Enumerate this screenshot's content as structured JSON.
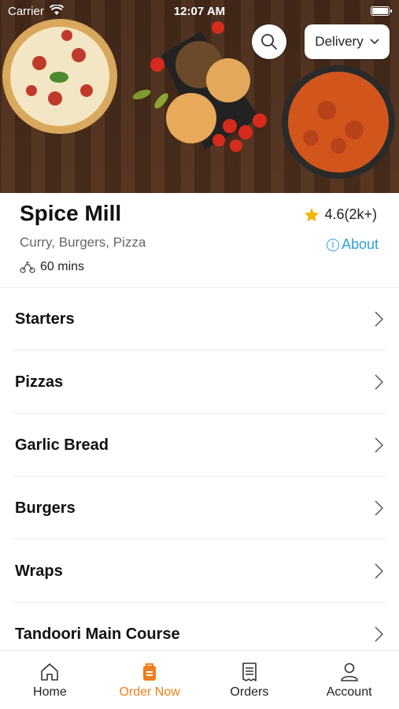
{
  "status_bar": {
    "carrier": "Carrier",
    "time": "12:07 AM"
  },
  "header": {
    "search_icon": "search-icon",
    "delivery_label": "Delivery"
  },
  "restaurant": {
    "name": "Spice Mill",
    "rating": "4.6(2k+)",
    "cuisines": "Curry, Burgers, Pizza",
    "about_label": "About",
    "eta": "60 mins"
  },
  "categories": [
    {
      "label": "Starters"
    },
    {
      "label": "Pizzas"
    },
    {
      "label": "Garlic Bread"
    },
    {
      "label": "Burgers"
    },
    {
      "label": "Wraps"
    },
    {
      "label": "Tandoori Main Course"
    }
  ],
  "tabs": [
    {
      "label": "Home",
      "icon": "home-icon"
    },
    {
      "label": "Order Now",
      "icon": "order-bag-icon"
    },
    {
      "label": "Orders",
      "icon": "receipt-icon"
    },
    {
      "label": "Account",
      "icon": "person-icon"
    }
  ],
  "colors": {
    "accent": "#f07d1a",
    "link": "#2ba3d6",
    "star": "#f5b400"
  }
}
